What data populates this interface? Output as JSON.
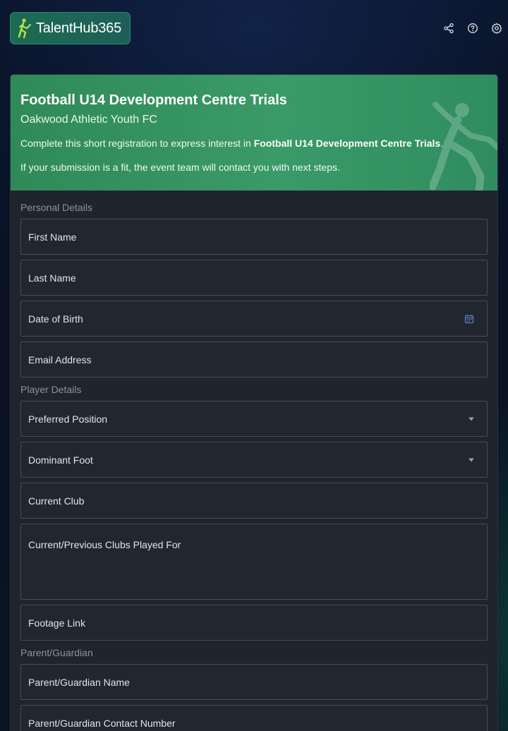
{
  "brand": {
    "name": "TalentHub365"
  },
  "header_icons": [
    "share-icon",
    "help-icon",
    "settings-icon"
  ],
  "colors": {
    "accent": "#3a9a68",
    "brand": "#1d6b52",
    "card": "#20242c"
  },
  "event": {
    "title": "Football U14 Development Centre Trials",
    "organizer": "Oakwood Athletic Youth FC",
    "intro_prefix": "Complete this short registration to express interest in ",
    "intro_event": "Football U14 Development Centre Trials",
    "intro_suffix": ".",
    "note": "If your submission is a fit, the event team will contact you with next steps."
  },
  "form": {
    "personal": {
      "label": "Personal Details",
      "first_name": "First Name",
      "last_name": "Last Name",
      "dob": "Date of Birth",
      "email": "Email Address"
    },
    "player": {
      "label": "Player Details",
      "position": "Preferred Position",
      "foot": "Dominant Foot",
      "current_club": "Current Club",
      "previous_clubs": "Current/Previous Clubs Played For",
      "footage": "Footage Link"
    },
    "guardian": {
      "label": "Parent/Guardian",
      "name": "Parent/Guardian Name",
      "contact": "Parent/Guardian Contact Number"
    }
  }
}
